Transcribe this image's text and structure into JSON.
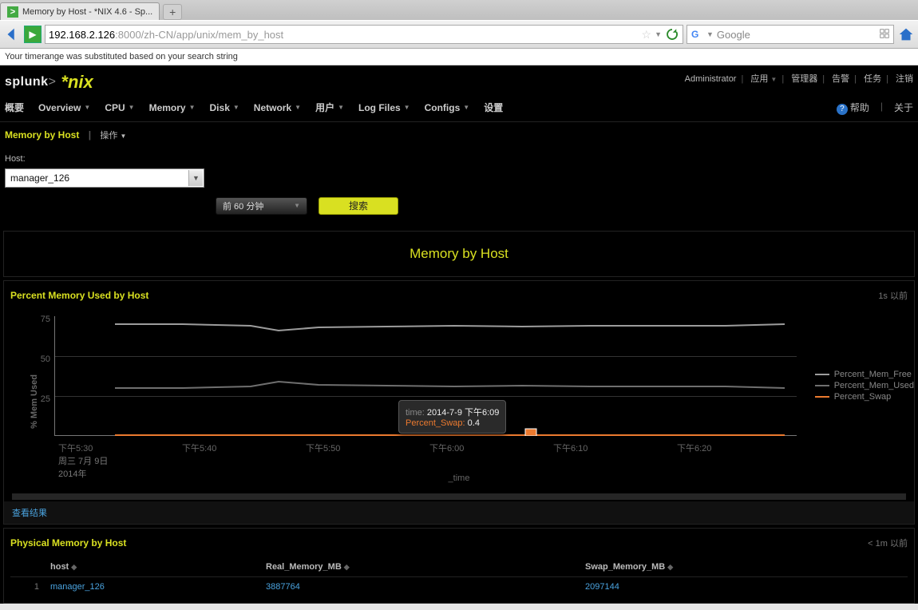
{
  "browser": {
    "tab_title": "Memory by Host - *NIX 4.6 - Sp...",
    "url_dark": "192.168.2.126",
    "url_light": ":8000/zh-CN/app/unix/mem_by_host",
    "search_engine": "Google"
  },
  "notice": "Your timerange was substituted based on your search string",
  "header_links": {
    "admin": "Administrator",
    "app": "应用",
    "manager": "管理器",
    "alerts": "告警",
    "jobs": "任务",
    "logout": "注销"
  },
  "logo": {
    "splunk": "splunk",
    "nix": "*nix"
  },
  "nav": {
    "items": [
      "概要",
      "Overview",
      "CPU",
      "Memory",
      "Disk",
      "Network",
      "用户",
      "Log Files",
      "Configs",
      "设置"
    ],
    "right": {
      "help": "帮助",
      "about": "关于"
    }
  },
  "subheader": {
    "title": "Memory by Host",
    "action": "操作"
  },
  "controls": {
    "host_label": "Host:",
    "host_value": "manager_126",
    "time_label": "前 60 分钟",
    "search_label": "搜索"
  },
  "main_title": "Memory by Host",
  "panel1": {
    "title": "Percent Memory Used by Host",
    "age": "1s 以前",
    "ylabel": "% Mem Used",
    "yticks": [
      "75",
      "50",
      "25"
    ],
    "xticks": [
      "下午5:30",
      "下午5:40",
      "下午5:50",
      "下午6:00",
      "下午6:10",
      "下午6:20"
    ],
    "xsub1": "周三 7月 9日",
    "xsub2": "2014年",
    "xlabel": "_time",
    "legend": [
      "Percent_Mem_Free",
      "Percent_Mem_Used",
      "Percent_Swap"
    ],
    "legend_colors": [
      "#9c9c9c",
      "#6f6f6f",
      "#ec7a2f"
    ],
    "tooltip": {
      "time_label": "time:",
      "time_value": "2014-7-9 下午6:09",
      "series_label": "Percent_Swap:",
      "series_value": "0.4"
    },
    "view_results": "查看结果"
  },
  "panel2": {
    "title": "Physical Memory by Host",
    "age": "< 1m 以前",
    "columns": [
      "host",
      "Real_Memory_MB",
      "Swap_Memory_MB"
    ],
    "row_index": "1",
    "row": {
      "host": "manager_126",
      "real": "3887764",
      "swap": "2097144"
    }
  },
  "chart_data": {
    "type": "line",
    "title": "Percent Memory Used by Host",
    "xlabel": "_time",
    "ylabel": "% Mem Used",
    "ylim": [
      0,
      75
    ],
    "x": [
      "17:30",
      "17:35",
      "17:40",
      "17:45",
      "17:50",
      "17:55",
      "18:00",
      "18:05",
      "18:10",
      "18:15",
      "18:20",
      "18:25"
    ],
    "series": [
      {
        "name": "Percent_Mem_Free",
        "color": "#9c9c9c",
        "values": [
          70,
          70,
          69,
          68,
          68,
          69,
          69,
          69,
          69,
          69,
          69,
          69
        ]
      },
      {
        "name": "Percent_Mem_Used",
        "color": "#6f6f6f",
        "values": [
          30,
          30,
          31,
          32,
          32,
          31,
          31,
          31,
          31,
          31,
          31,
          31
        ]
      },
      {
        "name": "Percent_Swap",
        "color": "#ec7a2f",
        "values": [
          0.4,
          0.4,
          0.4,
          0.4,
          0.4,
          0.4,
          0.4,
          0.4,
          0.4,
          0.4,
          0.4,
          0.4
        ]
      }
    ],
    "tooltip_point": {
      "time": "2014-7-9 下午6:09",
      "series": "Percent_Swap",
      "value": 0.4
    }
  }
}
